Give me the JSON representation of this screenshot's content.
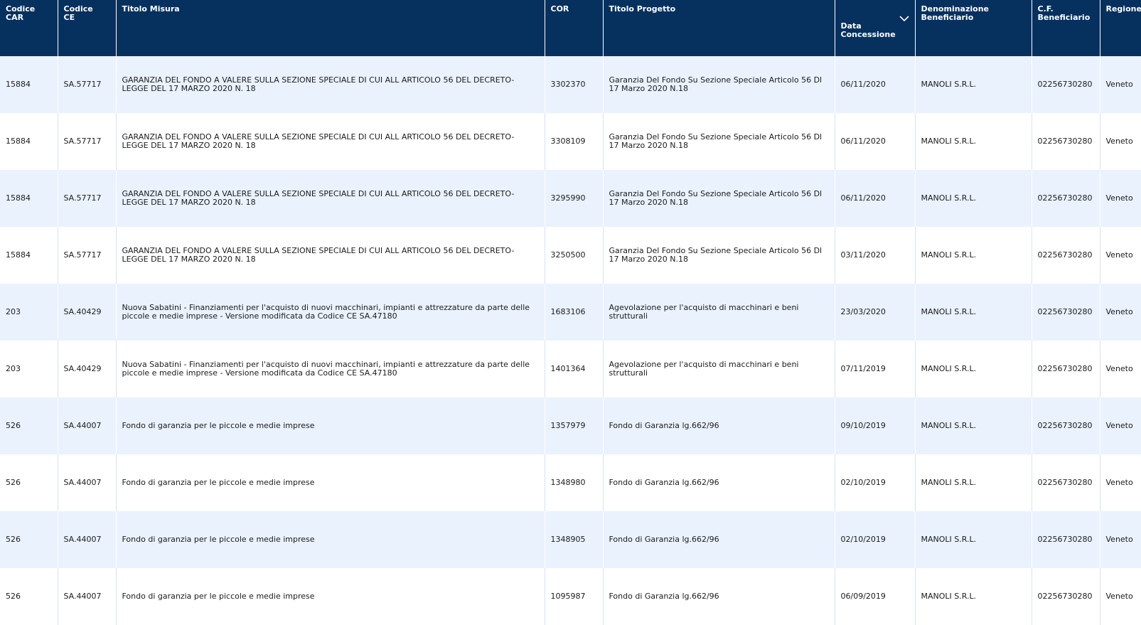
{
  "table": {
    "headers": [
      "Codice\nCAR",
      "Codice\nCE",
      "Titolo Misura",
      "COR",
      "Titolo Progetto",
      "Data\nConcessione",
      "Denominazione\nBeneficiario",
      "C.F.\nBeneficiario",
      "Regione"
    ],
    "sort_icon": "chevron-down-icon",
    "rows": [
      [
        "15884",
        "SA.57717",
        "GARANZIA DEL FONDO A VALERE SULLA SEZIONE SPECIALE DI CUI ALL ARTICOLO 56 DEL DECRETO-LEGGE DEL 17 MARZO 2020 N. 18",
        "3302370",
        "Garanzia Del Fondo Su Sezione Speciale Articolo 56 Dl 17 Marzo 2020 N.18",
        "06/11/2020",
        "MANOLI S.R.L.",
        "02256730280",
        "Veneto"
      ],
      [
        "15884",
        "SA.57717",
        "GARANZIA DEL FONDO A VALERE SULLA SEZIONE SPECIALE DI CUI ALL ARTICOLO 56 DEL DECRETO-LEGGE DEL 17 MARZO 2020 N. 18",
        "3308109",
        "Garanzia Del Fondo Su Sezione Speciale Articolo 56 Dl 17 Marzo 2020 N.18",
        "06/11/2020",
        "MANOLI S.R.L.",
        "02256730280",
        "Veneto"
      ],
      [
        "15884",
        "SA.57717",
        "GARANZIA DEL FONDO A VALERE SULLA SEZIONE SPECIALE DI CUI ALL ARTICOLO 56 DEL DECRETO-LEGGE DEL 17 MARZO 2020 N. 18",
        "3295990",
        "Garanzia Del Fondo Su Sezione Speciale Articolo 56 Dl 17 Marzo 2020 N.18",
        "06/11/2020",
        "MANOLI S.R.L.",
        "02256730280",
        "Veneto"
      ],
      [
        "15884",
        "SA.57717",
        "GARANZIA DEL FONDO A VALERE SULLA SEZIONE SPECIALE DI CUI ALL ARTICOLO 56 DEL DECRETO-LEGGE DEL 17 MARZO 2020 N. 18",
        "3250500",
        "Garanzia Del Fondo Su Sezione Speciale Articolo 56 Dl 17 Marzo 2020 N.18",
        "03/11/2020",
        "MANOLI S.R.L.",
        "02256730280",
        "Veneto"
      ],
      [
        "203",
        "SA.40429",
        "Nuova Sabatini - Finanziamenti per l'acquisto di nuovi macchinari, impianti e attrezzature da parte delle piccole e medie imprese - Versione modificata da Codice CE SA.47180",
        "1683106",
        "Agevolazione per l'acquisto di macchinari e beni strutturali",
        "23/03/2020",
        "MANOLI S.R.L.",
        "02256730280",
        "Veneto"
      ],
      [
        "203",
        "SA.40429",
        "Nuova Sabatini - Finanziamenti per l'acquisto di nuovi macchinari, impianti e attrezzature da parte delle piccole e medie imprese - Versione modificata da Codice CE SA.47180",
        "1401364",
        "Agevolazione per l'acquisto di macchinari e beni strutturali",
        "07/11/2019",
        "MANOLI S.R.L.",
        "02256730280",
        "Veneto"
      ],
      [
        "526",
        "SA.44007",
        "Fondo di garanzia per le piccole e medie imprese",
        "1357979",
        "Fondo di Garanzia lg.662/96",
        "09/10/2019",
        "MANOLI S.R.L.",
        "02256730280",
        "Veneto"
      ],
      [
        "526",
        "SA.44007",
        "Fondo di garanzia per le piccole e medie imprese",
        "1348980",
        "Fondo di Garanzia lg.662/96",
        "02/10/2019",
        "MANOLI S.R.L.",
        "02256730280",
        "Veneto"
      ],
      [
        "526",
        "SA.44007",
        "Fondo di garanzia per le piccole e medie imprese",
        "1348905",
        "Fondo di Garanzia lg.662/96",
        "02/10/2019",
        "MANOLI S.R.L.",
        "02256730280",
        "Veneto"
      ],
      [
        "526",
        "SA.44007",
        "Fondo di garanzia per le piccole e medie imprese",
        "1095987",
        "Fondo di Garanzia lg.662/96",
        "06/09/2019",
        "MANOLI S.R.L.",
        "02256730280",
        "Veneto"
      ]
    ]
  }
}
